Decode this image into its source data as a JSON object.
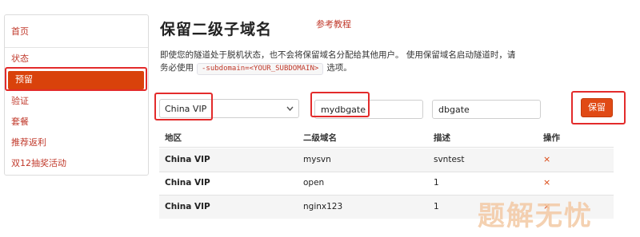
{
  "sidebar": {
    "items": [
      {
        "label": "首页",
        "active": false
      },
      {
        "label": "状态",
        "active": false
      },
      {
        "label": "预留",
        "active": true
      },
      {
        "label": "验证",
        "active": false
      },
      {
        "label": "套餐",
        "active": false
      },
      {
        "label": "推荐返利",
        "active": false
      },
      {
        "label": "双12抽奖活动",
        "active": false
      }
    ]
  },
  "header": {
    "title": "保留二级子域名",
    "ref_link": "参考教程"
  },
  "description": {
    "text_before": "即使您的隧道处于脱机状态，也不会将保留域名分配给其他用户。 使用保留域名启动隧道时，请务必使用",
    "code": "-subdomain=<YOUR_SUBDOMAIN>",
    "text_after": "选项。"
  },
  "form": {
    "region_select": {
      "value": "China VIP",
      "icon": "chevron-down-icon"
    },
    "subdomain_input": {
      "value": "mydbgate"
    },
    "description_input": {
      "value": "dbgate"
    },
    "reserve_button": "保留"
  },
  "table": {
    "headers": [
      "地区",
      "二级域名",
      "描述",
      "操作"
    ],
    "rows": [
      {
        "region": "China VIP",
        "subdomain": "mysvn",
        "description": "svntest",
        "action": "×"
      },
      {
        "region": "China VIP",
        "subdomain": "open",
        "description": "1",
        "action": "×"
      },
      {
        "region": "China VIP",
        "subdomain": "nginx123",
        "description": "1",
        "action": "×"
      }
    ]
  },
  "watermark": "题解无忧",
  "colors": {
    "accent": "#d9420b",
    "highlight_box": "#e32b2b",
    "link": "#c0392b"
  }
}
